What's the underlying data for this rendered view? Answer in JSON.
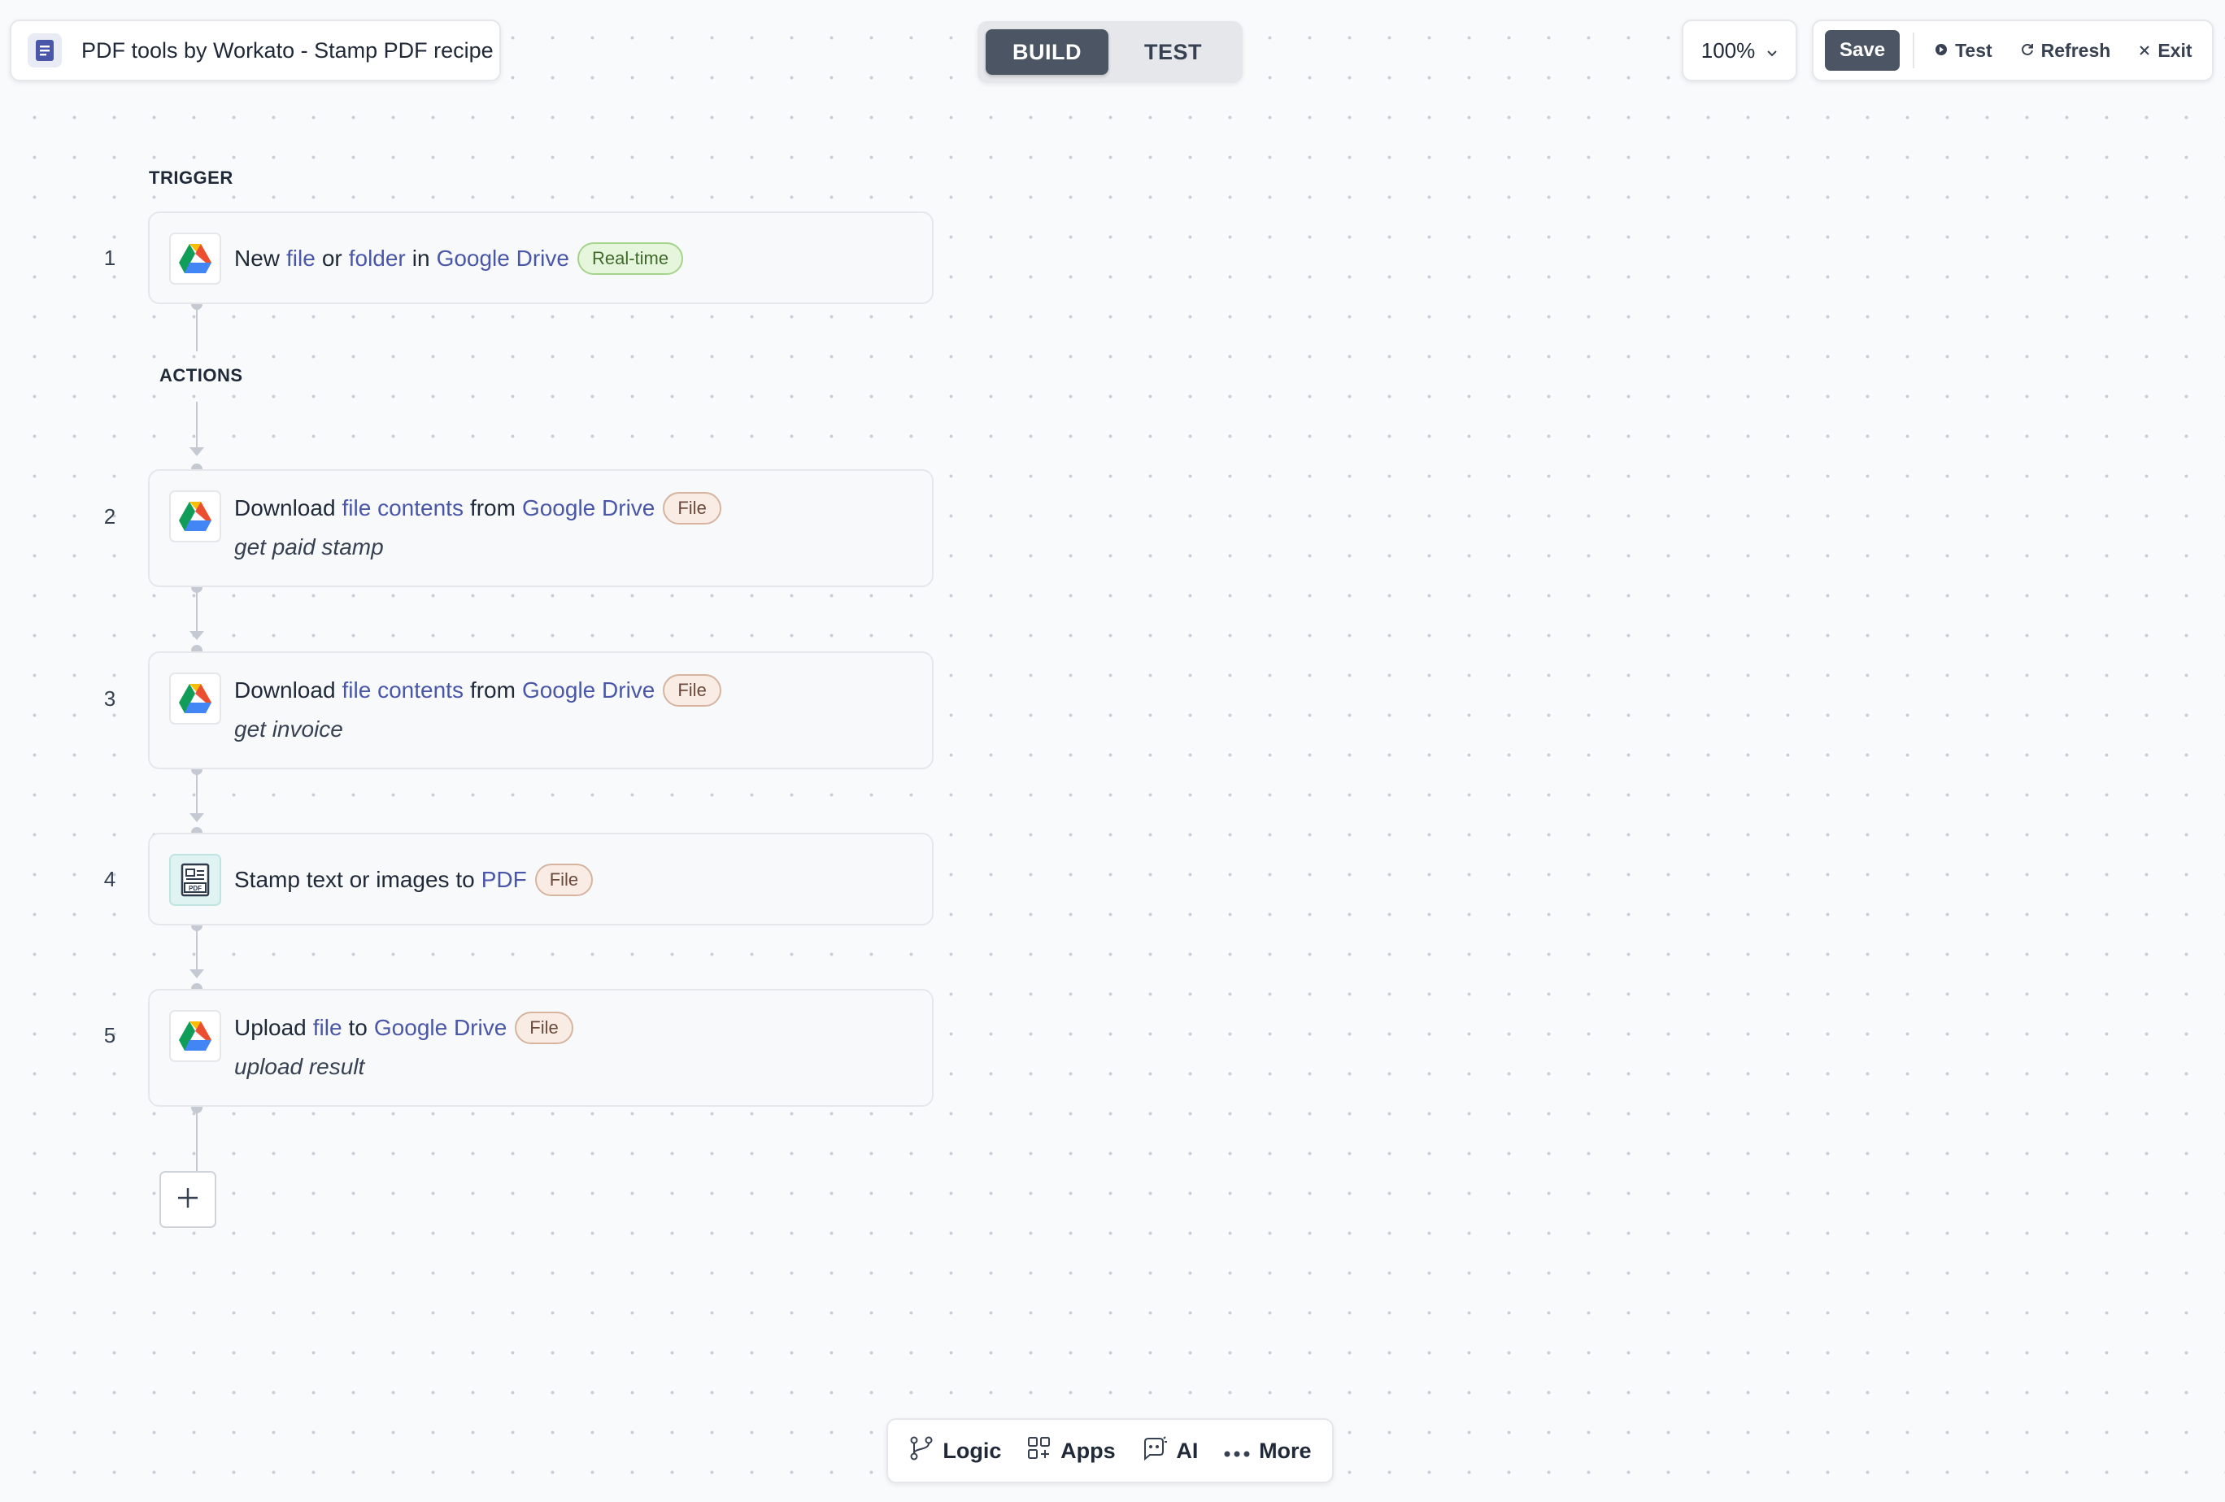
{
  "header": {
    "recipe_title": "PDF tools by Workato - Stamp PDF recipe",
    "modes": [
      "BUILD",
      "TEST"
    ],
    "active_mode": "BUILD",
    "zoom": "100%",
    "save_label": "Save",
    "test_label": "Test",
    "refresh_label": "Refresh",
    "exit_label": "Exit"
  },
  "flow": {
    "trigger_label": "TRIGGER",
    "actions_label": "ACTIONS",
    "steps": [
      {
        "number": "1",
        "app_icon": "google-drive-icon",
        "parts": [
          "New",
          "file",
          "or",
          "folder",
          "in",
          "Google Drive"
        ],
        "badge": "Real-time",
        "subtitle": ""
      },
      {
        "number": "2",
        "app_icon": "google-drive-icon",
        "parts": [
          "Download",
          "file contents",
          "from",
          "Google Drive"
        ],
        "badge": "File",
        "subtitle": "get paid stamp"
      },
      {
        "number": "3",
        "app_icon": "google-drive-icon",
        "parts": [
          "Download",
          "file contents",
          "from",
          "Google Drive"
        ],
        "badge": "File",
        "subtitle": "get invoice"
      },
      {
        "number": "4",
        "app_icon": "pdf-tools-icon",
        "parts": [
          "Stamp text or images to",
          "PDF"
        ],
        "badge": "File",
        "subtitle": ""
      },
      {
        "number": "5",
        "app_icon": "google-drive-icon",
        "parts": [
          "Upload",
          "file",
          "to",
          "Google Drive"
        ],
        "badge": "File",
        "subtitle": "upload result"
      }
    ]
  },
  "toolbar": {
    "logic_label": "Logic",
    "apps_label": "Apps",
    "ai_label": "AI",
    "more_label": "More"
  },
  "colors": {
    "link": "#4a57a8",
    "primary_dark": "#4b5563",
    "badge_file_bg": "#f8ece4",
    "badge_realtime_bg": "#e6f6dc"
  }
}
